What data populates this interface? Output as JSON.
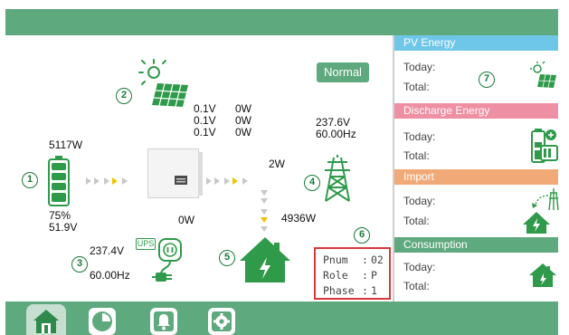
{
  "status": {
    "label": "Normal"
  },
  "pv": {
    "rows": [
      {
        "voltage": "0.1V",
        "power": "0W"
      },
      {
        "voltage": "0.1V",
        "power": "0W"
      },
      {
        "voltage": "0.1V",
        "power": "0W"
      }
    ]
  },
  "battery": {
    "power": "5117W",
    "soc": "75%",
    "voltage": "51.9V"
  },
  "grid": {
    "voltage": "237.6V",
    "frequency": "60.00Hz",
    "power": "2W"
  },
  "ups": {
    "voltage": "237.4V",
    "frequency": "60.00Hz",
    "power": "0W",
    "icon_label": "UPS"
  },
  "home": {
    "power": "4936W"
  },
  "inverter": {
    "pnum_label": "Pnum",
    "pnum": "02",
    "role_label": "Role",
    "role": "P",
    "phase_label": "Phase",
    "phase": "1"
  },
  "badges": [
    "1",
    "2",
    "3",
    "4",
    "5",
    "6",
    "7"
  ],
  "side": {
    "sections": [
      {
        "title": "PV Energy",
        "color": "#6ec6e9",
        "today_label": "Today:",
        "total_label": "Total:"
      },
      {
        "title": "Discharge Energy",
        "color": "#ee8fa3",
        "today_label": "Today:",
        "total_label": "Total:"
      },
      {
        "title": "Import",
        "color": "#f2a978",
        "today_label": "Today:",
        "total_label": "Total:"
      },
      {
        "title": "Consumption",
        "color": "#5fa97e",
        "today_label": "Today:",
        "total_label": "Total:"
      }
    ]
  },
  "nav": {
    "tabs": [
      "home-icon",
      "pie-chart-icon",
      "bell-icon",
      "gear-icon"
    ]
  },
  "colors": {
    "header": "#5fa97e",
    "accent_green": "#2e9a4a",
    "arrow_yellow": "#f2c200",
    "alert_red": "#d63a3a"
  }
}
